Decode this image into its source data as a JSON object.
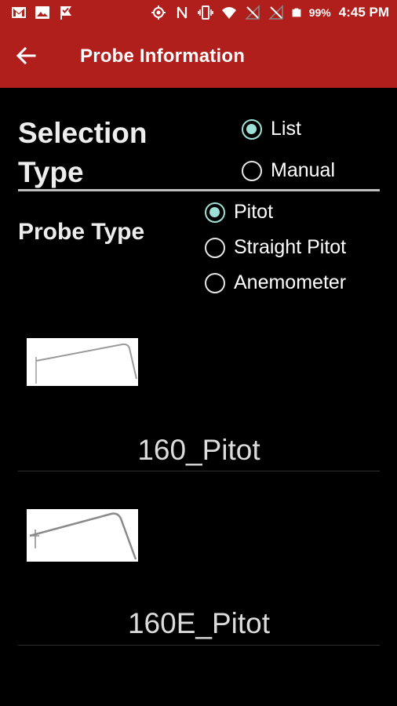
{
  "status_bar": {
    "icons_left": [
      "gmail-icon",
      "image-icon",
      "check-flag-icon"
    ],
    "icons_right": [
      "location-icon",
      "nfc-icon",
      "vibrate-icon",
      "wifi-icon",
      "no-signal-icon",
      "no-signal-icon",
      "battery-icon"
    ],
    "battery": "99%",
    "time": "4:45 PM"
  },
  "app_bar": {
    "title": "Probe Information",
    "back_icon": "arrow-left-icon",
    "color": "#b01f1b"
  },
  "selection_type": {
    "label": "Selection Type",
    "options": [
      {
        "label": "List",
        "checked": true
      },
      {
        "label": "Manual",
        "checked": false
      }
    ]
  },
  "probe_type": {
    "label": "Probe Type",
    "options": [
      {
        "label": "Pitot",
        "checked": true
      },
      {
        "label": "Straight Pitot",
        "checked": false
      },
      {
        "label": "Anemometer",
        "checked": false
      }
    ]
  },
  "probes": [
    {
      "name": "160_Pitot",
      "image": "pitot-tube-image"
    },
    {
      "name": "160E_Pitot",
      "image": "pitot-tube-image"
    }
  ],
  "colors": {
    "accent": "#9fe0d6",
    "background": "#000000"
  }
}
